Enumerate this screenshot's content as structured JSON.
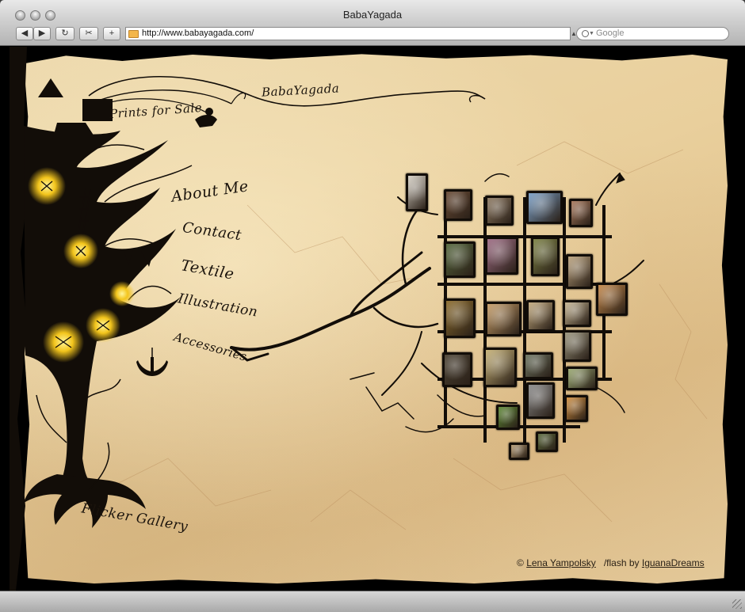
{
  "window": {
    "title": "BabaYagada"
  },
  "toolbar": {
    "back_label": "◀",
    "forward_label": "▶",
    "reload_label": "↻",
    "snapback_label": "✂",
    "add_label": "+",
    "url": "http://www.babayagada.com/",
    "search_placeholder": "Google"
  },
  "site": {
    "logo_text": "BabaYagada",
    "nav": {
      "prints": "Prints for Sale",
      "about": "About Me",
      "contact": "Contact",
      "textile": "Textile",
      "illustration": "Illustration",
      "accessories": "Accessories",
      "flickr": "Flicker Gallery"
    },
    "credits": {
      "copyright": "©",
      "author": "Lena Yampolsky",
      "flash_by": "/flash by",
      "studio": "IguanaDreams"
    }
  },
  "colors": {
    "parchment": "#e9cf9c",
    "ink": "#120d08",
    "lantern": "#f3c51c"
  },
  "gallery": {
    "thumbnails": [
      {
        "name": "face-doll",
        "color": "#d8d2c6"
      },
      {
        "name": "red-eye",
        "color": "#6a4b35"
      },
      {
        "name": "gnome-portrait",
        "color": "#8f7b63"
      },
      {
        "name": "blue-creature",
        "color": "#7da2c9"
      },
      {
        "name": "red-bird",
        "color": "#a97a5d"
      },
      {
        "name": "green-swirl",
        "color": "#56683d"
      },
      {
        "name": "pink-planet",
        "color": "#a06e86"
      },
      {
        "name": "green-face",
        "color": "#7d8345"
      },
      {
        "name": "landscape-sketch",
        "color": "#bda47e"
      },
      {
        "name": "orange-beast",
        "color": "#c78a4b"
      },
      {
        "name": "brown-spiral",
        "color": "#8d6d2e"
      },
      {
        "name": "baby-sketch",
        "color": "#c9a06a"
      },
      {
        "name": "ink-drawing",
        "color": "#c4ab7f"
      },
      {
        "name": "pencil-owl",
        "color": "#c7b693"
      },
      {
        "name": "bug-sketch",
        "color": "#9b957d"
      },
      {
        "name": "dark-eye",
        "color": "#4b4233"
      },
      {
        "name": "yellow-field",
        "color": "#c9b478"
      },
      {
        "name": "tile-pattern",
        "color": "#6d7561"
      },
      {
        "name": "green-lizard",
        "color": "#9fae77"
      },
      {
        "name": "orange-petals",
        "color": "#d28f3f"
      },
      {
        "name": "bw-stripes",
        "color": "#8c8c8c"
      },
      {
        "name": "green-target",
        "color": "#5e8a35"
      },
      {
        "name": "green-dots",
        "color": "#5b6a3c"
      },
      {
        "name": "portrait-sketch",
        "color": "#b59b73"
      }
    ]
  }
}
